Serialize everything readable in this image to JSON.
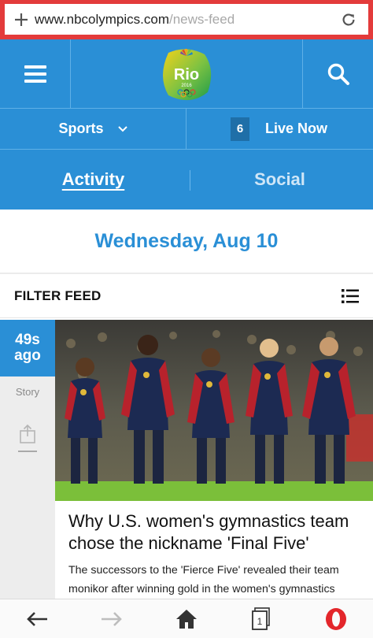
{
  "browser": {
    "url_host": "www.nbcolympics.com",
    "url_path": "/news-feed",
    "tab_count": "1",
    "icons": [
      "plus-icon",
      "reload-icon",
      "back-arrow-icon",
      "forward-arrow-icon",
      "home-icon",
      "tabs-icon",
      "opera-menu-icon"
    ]
  },
  "header": {
    "logo_text": "Rio",
    "logo_year": "2016",
    "menu_icon": "hamburger-icon",
    "search_icon": "search-icon",
    "colors": {
      "primary": "#2a8fd6",
      "dark": "#1f6fa8",
      "accent": "#e33b3b"
    }
  },
  "nav": {
    "sports_label": "Sports",
    "live_count": "6",
    "live_label": "Live Now"
  },
  "tabs": [
    {
      "label": "Activity",
      "active": true
    },
    {
      "label": "Social",
      "active": false
    }
  ],
  "feed": {
    "date": "Wednesday, Aug 10",
    "filter_label": "FILTER FEED",
    "items": [
      {
        "time_value": "49s",
        "time_unit": "ago",
        "type": "Story",
        "headline": "Why U.S. women's gymnastics team chose the nickname 'Final Five'",
        "summary": "The successors to the 'Fierce Five' revealed their team monikor after winning gold in the women's gymnastics"
      }
    ]
  }
}
